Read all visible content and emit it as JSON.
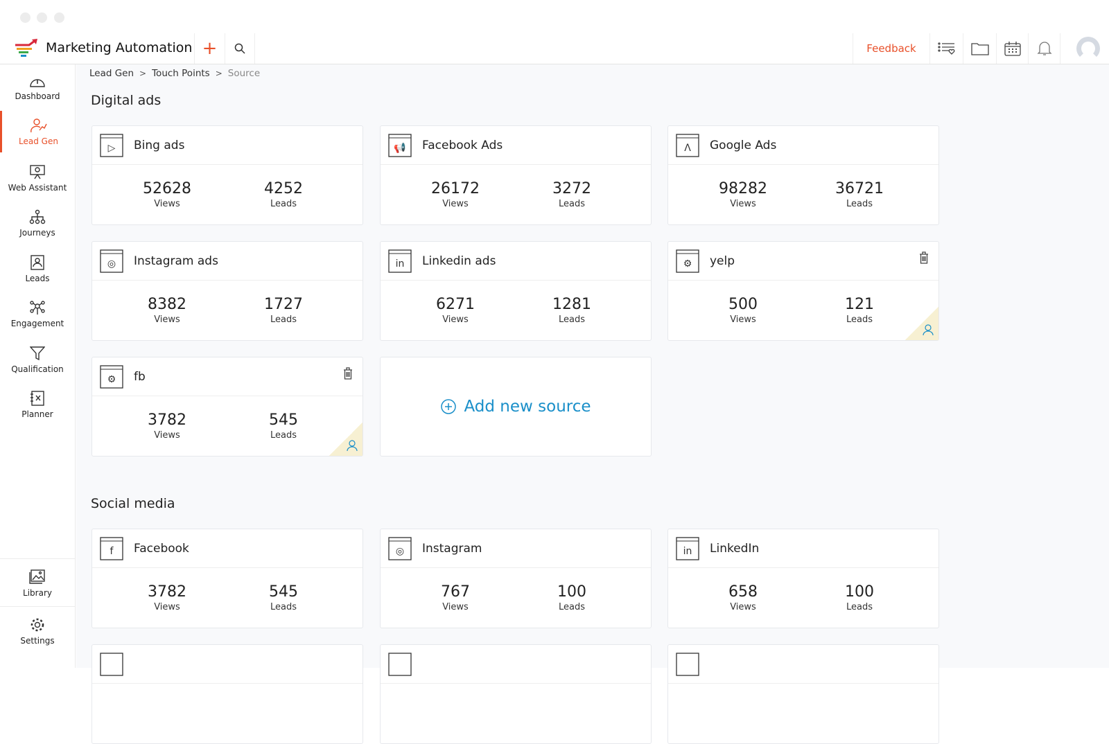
{
  "app": {
    "title": "Marketing Automation",
    "feedback": "Feedback"
  },
  "breadcrumb": [
    "Lead Gen",
    "Touch Points",
    "Source"
  ],
  "sidebar": [
    {
      "label": "Dashboard",
      "icon": "dashboard-icon"
    },
    {
      "label": "Lead Gen",
      "icon": "lead-gen-icon",
      "active": true
    },
    {
      "label": "Web Assistant",
      "icon": "web-assistant-icon"
    },
    {
      "label": "Journeys",
      "icon": "journeys-icon"
    },
    {
      "label": "Leads",
      "icon": "leads-icon"
    },
    {
      "label": "Engagement",
      "icon": "engagement-icon"
    },
    {
      "label": "Qualification",
      "icon": "funnel-icon"
    },
    {
      "label": "Planner",
      "icon": "planner-icon"
    }
  ],
  "sidebar_bottom": [
    {
      "label": "Library",
      "icon": "image-icon"
    },
    {
      "label": "Settings",
      "icon": "gear-icon"
    }
  ],
  "sections": [
    {
      "title": "Digital ads",
      "add_label": "Add new source",
      "cards": [
        {
          "name": "Bing ads",
          "views": "52628",
          "leads": "4252",
          "icon": "bing-ads-icon"
        },
        {
          "name": "Facebook Ads",
          "views": "26172",
          "leads": "3272",
          "icon": "megaphone-icon"
        },
        {
          "name": "Google Ads",
          "views": "98282",
          "leads": "36721",
          "icon": "google-ads-icon"
        },
        {
          "name": "Instagram ads",
          "views": "8382",
          "leads": "1727",
          "icon": "instagram-ads-icon"
        },
        {
          "name": "Linkedin ads",
          "views": "6271",
          "leads": "1281",
          "icon": "linkedin-ads-icon"
        },
        {
          "name": "yelp",
          "views": "500",
          "leads": "121",
          "icon": "gear-icon",
          "custom": true
        },
        {
          "name": "fb",
          "views": "3782",
          "leads": "545",
          "icon": "gear-icon",
          "custom": true
        }
      ]
    },
    {
      "title": "Social media",
      "cards": [
        {
          "name": "Facebook",
          "views": "3782",
          "leads": "545",
          "icon": "facebook-icon"
        },
        {
          "name": "Instagram",
          "views": "767",
          "leads": "100",
          "icon": "instagram-icon"
        },
        {
          "name": "LinkedIn",
          "views": "658",
          "leads": "100",
          "icon": "linkedin-icon"
        }
      ]
    }
  ],
  "labels": {
    "views": "Views",
    "leads": "Leads"
  },
  "colors": {
    "accent": "#e8502a",
    "link": "#1a8fc9"
  }
}
